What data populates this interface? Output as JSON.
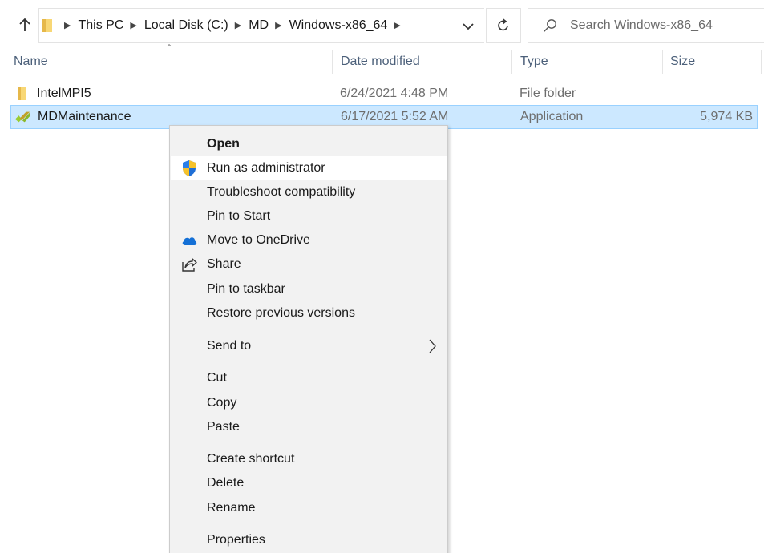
{
  "address_bar": {
    "breadcrumbs": [
      "This PC",
      "Local Disk (C:)",
      "MD",
      "Windows-x86_64"
    ],
    "search_placeholder": "Search Windows-x86_64"
  },
  "columns": {
    "name": "Name",
    "date_modified": "Date modified",
    "type": "Type",
    "size": "Size"
  },
  "files": [
    {
      "name": "IntelMPI5",
      "date_modified": "6/24/2021 4:48 PM",
      "type": "File folder",
      "size": "",
      "icon": "folder-icon",
      "selected": false
    },
    {
      "name": "MDMaintenance",
      "date_modified": "6/17/2021 5:52 AM",
      "type": "Application",
      "size": "5,974 KB",
      "icon": "app-icon",
      "selected": true
    }
  ],
  "context_menu": {
    "items": [
      {
        "label": "Open",
        "bold": true
      },
      {
        "label": "Run as administrator",
        "icon": "uac-shield-icon",
        "hovered": true
      },
      {
        "label": "Troubleshoot compatibility"
      },
      {
        "label": "Pin to Start"
      },
      {
        "label": "Move to OneDrive",
        "icon": "onedrive-cloud-icon"
      },
      {
        "label": "Share",
        "icon": "share-icon"
      },
      {
        "label": "Pin to taskbar"
      },
      {
        "label": "Restore previous versions"
      },
      {
        "label": "Send to",
        "submenu": true
      },
      {
        "label": "Cut"
      },
      {
        "label": "Copy"
      },
      {
        "label": "Paste"
      },
      {
        "label": "Create shortcut"
      },
      {
        "label": "Delete"
      },
      {
        "label": "Rename"
      },
      {
        "label": "Properties"
      }
    ]
  },
  "colors": {
    "selection_bg": "#cce8ff",
    "selection_border": "#99d1ff",
    "menu_bg": "#f2f2f2",
    "folder_yellow": "#f8d775",
    "app_icon_green": "#9acd32"
  }
}
